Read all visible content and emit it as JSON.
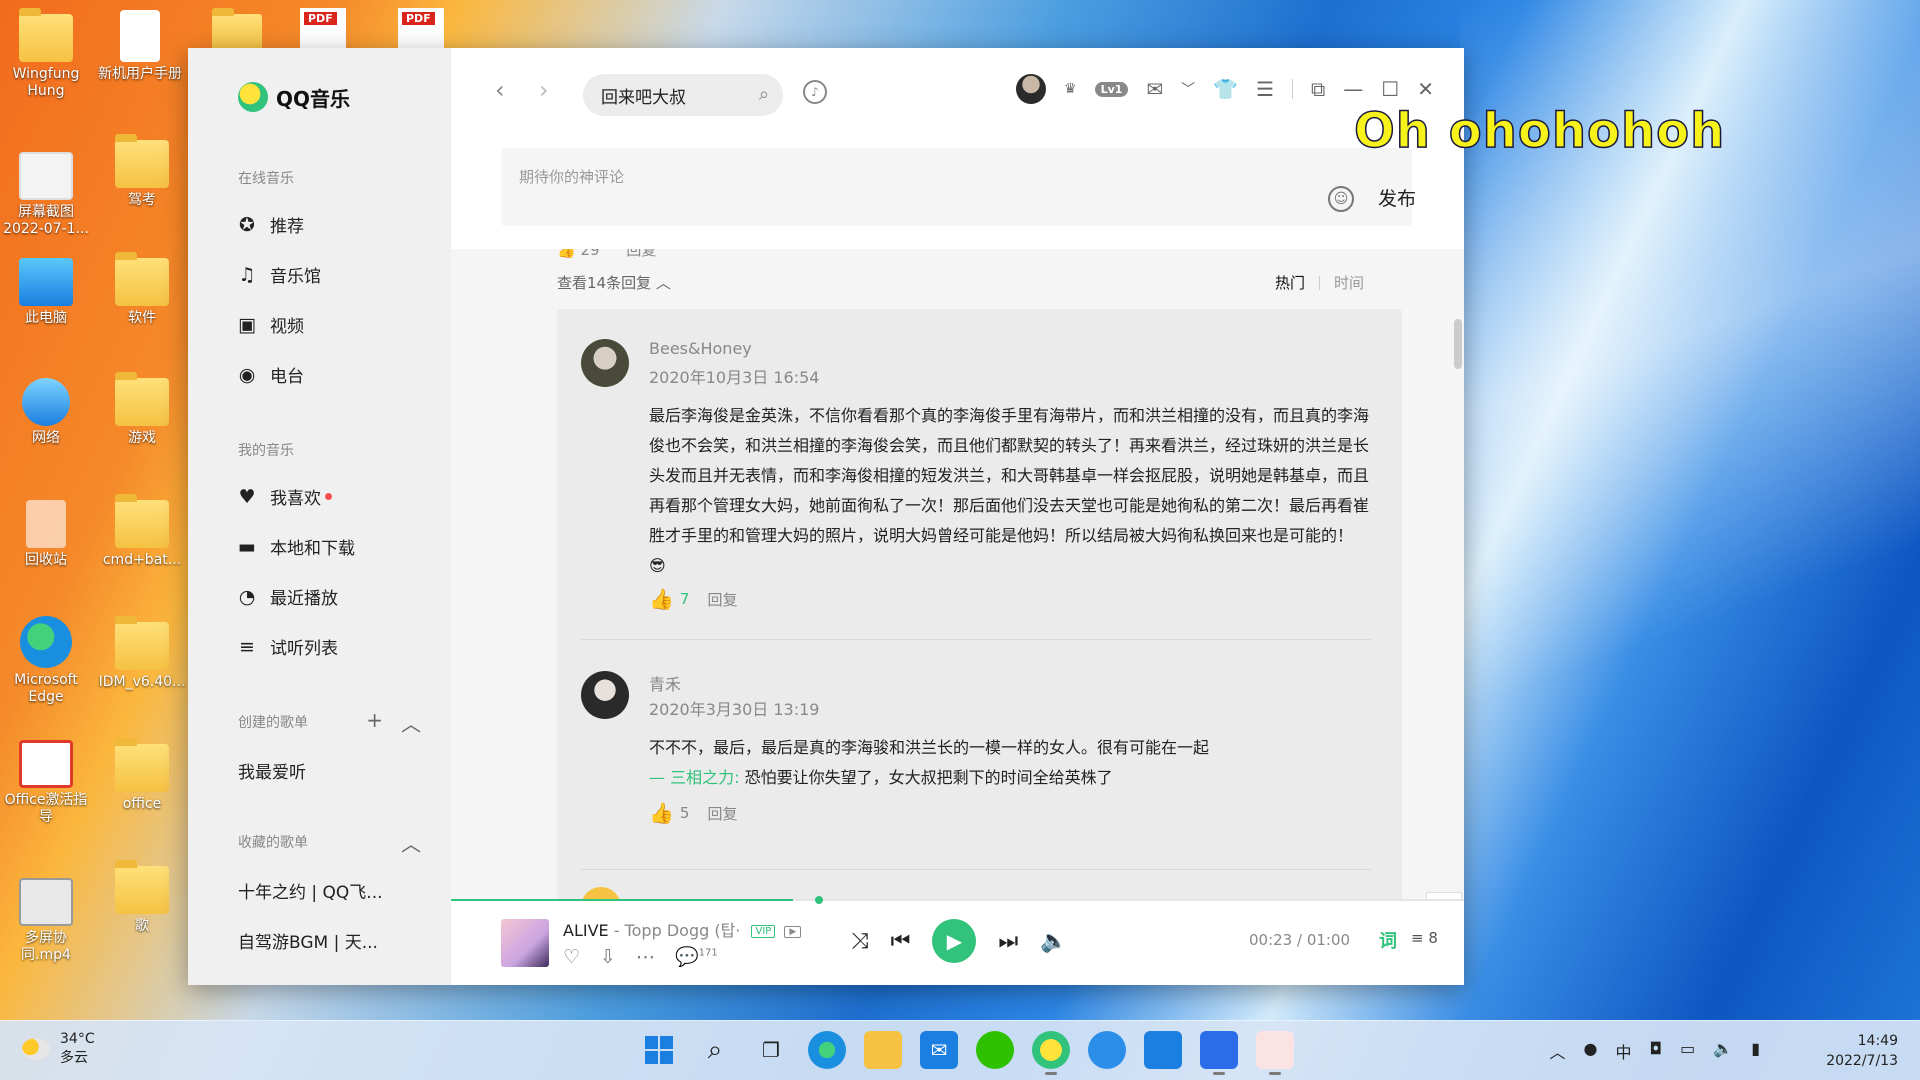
{
  "desktop": {
    "icons": [
      {
        "label": "Wingfung Hung",
        "icon": "user-folder-icon"
      },
      {
        "label": "新机用户手册",
        "icon": "document-shortcut-icon"
      },
      {
        "label": "屏幕截图 2022-07-1...",
        "icon": "screenshot-icon"
      },
      {
        "label": "驾考",
        "icon": "folder-icon"
      },
      {
        "label": "此电脑",
        "icon": "computer-icon"
      },
      {
        "label": "软件",
        "icon": "mail-folder-icon"
      },
      {
        "label": "网络",
        "icon": "network-icon"
      },
      {
        "label": "游戏",
        "icon": "folder-icon"
      },
      {
        "label": "回收站",
        "icon": "recycle-bin-icon"
      },
      {
        "label": "cmd+bat...",
        "icon": "folder-icon"
      },
      {
        "label": "Microsoft Edge",
        "icon": "edge-icon"
      },
      {
        "label": "IDM_v6.40...",
        "icon": "folder-icon"
      },
      {
        "label": "Office激活指导",
        "icon": "office-icon"
      },
      {
        "label": "office",
        "icon": "folder-icon"
      },
      {
        "label": "多屏协同.mp4",
        "icon": "video-icon"
      },
      {
        "label": "歌",
        "icon": "folder-icon"
      }
    ],
    "top_files": [
      "PDF",
      "PDF"
    ],
    "overlay_lyric": "Oh ohohohoh"
  },
  "app": {
    "name": "QQ音乐",
    "sidebar": {
      "online_title": "在线音乐",
      "online_items": [
        {
          "label": "推荐",
          "icon": "star-icon"
        },
        {
          "label": "音乐馆",
          "icon": "music-note-icon"
        },
        {
          "label": "视频",
          "icon": "video-camera-icon"
        },
        {
          "label": "电台",
          "icon": "radio-icon"
        }
      ],
      "my_title": "我的音乐",
      "my_items": [
        {
          "label": "我喜欢",
          "icon": "heart-icon"
        },
        {
          "label": "本地和下载",
          "icon": "monitor-icon"
        },
        {
          "label": "最近播放",
          "icon": "clock-icon"
        },
        {
          "label": "试听列表",
          "icon": "playlist-icon"
        }
      ],
      "created_title": "创建的歌单",
      "created_items": [
        "我最爱听"
      ],
      "collected_title": "收藏的歌单",
      "collected_items": [
        "十年之约 | QQ飞...",
        "自驾游BGM | 天..."
      ]
    },
    "topbar": {
      "search_value": "回来吧大叔",
      "level_badge": "Lv1"
    },
    "comment": {
      "placeholder": "期待你的神评论",
      "publish": "发布",
      "prev_likes": "29",
      "prev_reply": "回复",
      "view_replies": "查看14条回复",
      "sort_hot": "热门",
      "sort_time": "时间"
    },
    "replies": [
      {
        "user": "Bees&Honey",
        "time": "2020年10月3日 16:54",
        "text": "最后李海俊是金英洙，不信你看看那个真的李海俊手里有海带片，而和洪兰相撞的没有，而且真的李海俊也不会笑，和洪兰相撞的李海俊会笑，而且他们都默契的转头了！再来看洪兰，经过珠妍的洪兰是长头发而且并无表情，而和李海俊相撞的短发洪兰，和大哥韩基卓一样会抠屁股，说明她是韩基卓，而且再看那个管理女大妈，她前面徇私了一次！那后面他们没去天堂也可能是她徇私的第二次！最后再看崔胜才手里的和管理大妈的照片，说明大妈曾经可能是他妈！所以结局被大妈徇私换回来也是可能的！😎",
        "likes": "7",
        "reply": "回复"
      },
      {
        "user": "青禾",
        "time": "2020年3月30日 13:19",
        "text": "不不不，最后，最后是真的李海骏和洪兰长的一模一样的女人。很有可能在一起",
        "quote_user": "— 三相之力:",
        "quote_text": " 恐怕要让你失望了，女大叔把剩下的时间全给英株了",
        "likes": "5",
        "reply": "回复"
      }
    ],
    "player": {
      "title": "ALIVE",
      "artist": " - Topp Dogg (탑·",
      "vip": "VIP",
      "mv": "▶",
      "comment_count": "171",
      "time": "00:23 / 01:00",
      "lyric_btn": "词",
      "queue_count": "8",
      "progress": 0.338
    }
  },
  "taskbar": {
    "temp": "34°C",
    "weather": "多云",
    "time": "14:49",
    "date": "2022/7/13"
  }
}
